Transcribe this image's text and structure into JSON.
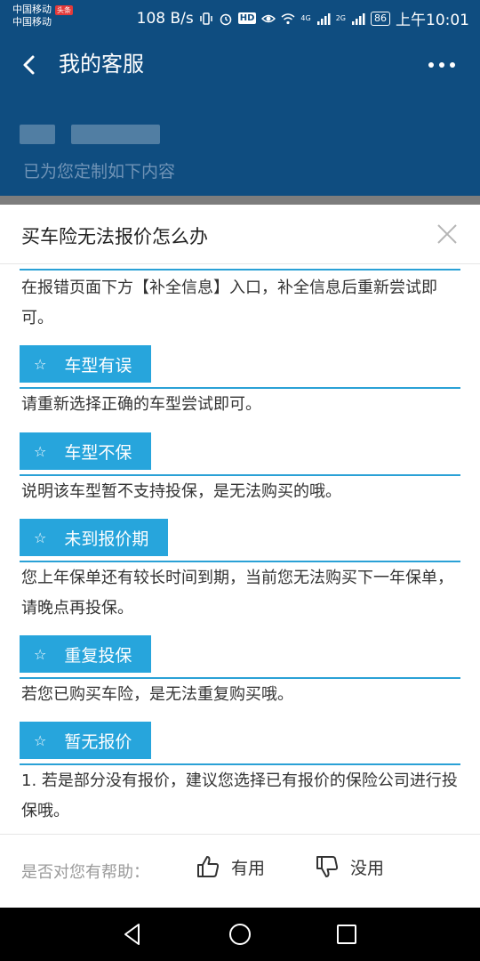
{
  "status_bar": {
    "carrier_1": "中国移动",
    "carrier_2": "中国移动",
    "news_badge": "头条",
    "net_speed": "108 B/s",
    "hd_badge": "HD",
    "signal_1_tag": "4G",
    "signal_2_tag": "2G",
    "battery": "86",
    "time": "上午10:01"
  },
  "header": {
    "title": "我的客服",
    "subtitle": "已为您定制如下内容"
  },
  "dialog": {
    "title": "买车险无法报价怎么办",
    "items": [
      {
        "text": "在报错页面下方【补全信息】入口，补全信息后重新尝试即可。"
      },
      {
        "tag": "车型有误",
        "text": "请重新选择正确的车型尝试即可。"
      },
      {
        "tag": "车型不保",
        "text": "说明该车型暂不支持投保，是无法购买的哦。"
      },
      {
        "tag": "未到报价期",
        "text": "您上年保单还有较长时间到期，当前您无法购买下一年保单，请晚点再投保。"
      },
      {
        "tag": "重复投保",
        "text": "若您已购买车险，是无法重复购买哦。"
      },
      {
        "tag": "暂无报价",
        "text": "1. 若是部分没有报价，建议您选择已有报价的保险公司进行投保哦。"
      }
    ],
    "star_glyph": "☆"
  },
  "footer": {
    "question": "是否对您有帮助：",
    "useful": "有用",
    "useless": "没用"
  },
  "colors": {
    "header_bg": "#0f4d80",
    "accent": "#27a5dc",
    "text": "#333333"
  }
}
